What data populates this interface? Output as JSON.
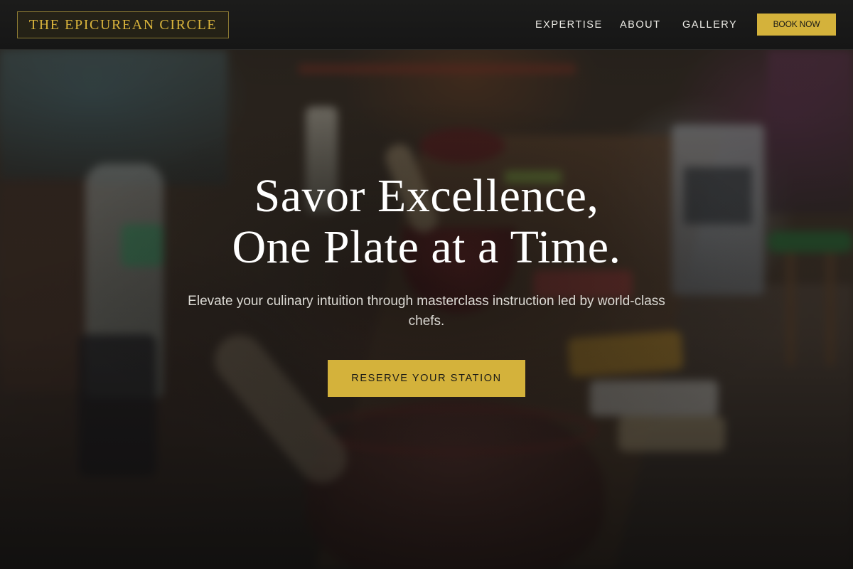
{
  "header": {
    "logo_text": "THE EPICUREAN CIRCLE",
    "nav": {
      "expertise": "EXPERTISE",
      "about": "ABOUT",
      "gallery": "GALLERY"
    },
    "book_button": "BOOK NOW"
  },
  "hero": {
    "title_line_1": "Savor Excellence,",
    "title_line_2": "One Plate at a Time.",
    "subtitle": "Elevate your culinary intuition through masterclass instruction led by world-class chefs.",
    "cta_label": "RESERVE YOUR STATION"
  },
  "theme": {
    "accent_gold": "#d4b23b",
    "header_bg": "#1a1a1a",
    "text_light": "#ffffff"
  }
}
